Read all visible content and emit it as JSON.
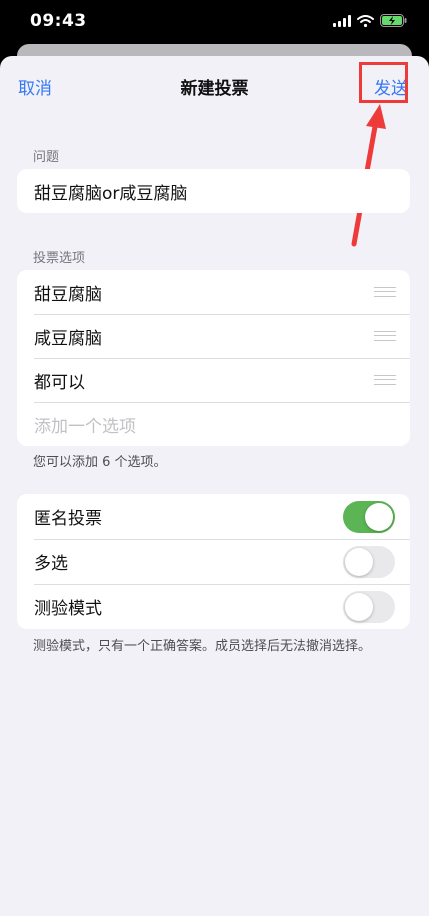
{
  "status_bar": {
    "time": "09:43",
    "icons": [
      "signal-icon",
      "wifi-icon",
      "battery-charging-icon"
    ]
  },
  "nav": {
    "cancel_label": "取消",
    "title": "新建投票",
    "send_label": "发送"
  },
  "question": {
    "section_label": "问题",
    "value": "甜豆腐脑or咸豆腐脑"
  },
  "options": {
    "section_label": "投票选项",
    "items": [
      "甜豆腐脑",
      "咸豆腐脑",
      "都可以"
    ],
    "add_placeholder": "添加一个选项",
    "footnote": "您可以添加 6 个选项。"
  },
  "settings": {
    "items": [
      {
        "label": "匿名投票",
        "on": true
      },
      {
        "label": "多选",
        "on": false
      },
      {
        "label": "测验模式",
        "on": false
      }
    ],
    "footnote": "测验模式，只有一个正确答案。成员选择后无法撤消选择。"
  },
  "colors": {
    "accent": "#3478f6",
    "toggle_on": "#5bb554",
    "annotation": "#ef3a3a"
  }
}
